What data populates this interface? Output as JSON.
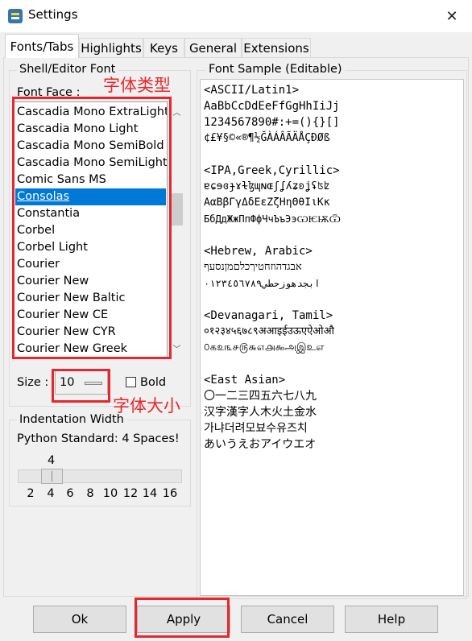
{
  "window": {
    "title": "Settings"
  },
  "tabs": [
    {
      "label": "Fonts/Tabs"
    },
    {
      "label": "Highlights"
    },
    {
      "label": "Keys"
    },
    {
      "label": "General"
    },
    {
      "label": "Extensions"
    }
  ],
  "font_group": {
    "legend": "Shell/Editor Font",
    "face_label": "Font Face :",
    "fonts": [
      "Cascadia Mono ExtraLight",
      "Cascadia Mono Light",
      "Cascadia Mono SemiBold",
      "Cascadia Mono SemiLight",
      "Comic Sans MS",
      "Consolas",
      "Constantia",
      "Corbel",
      "Corbel Light",
      "Courier",
      "Courier New",
      "Courier New Baltic",
      "Courier New CE",
      "Courier New CYR",
      "Courier New Greek"
    ],
    "selected_font": "Consolas",
    "size_label": "Size :",
    "size_value": "10",
    "bold_label": "Bold",
    "bold_checked": false
  },
  "annotations": {
    "font_type_note": "字体类型",
    "font_size_note": "字体大小"
  },
  "indent_group": {
    "legend": "Indentation Width",
    "description": "Python Standard: 4 Spaces!",
    "current_value": "4",
    "ticks": [
      "2",
      "4",
      "6",
      "8",
      "10",
      "12",
      "14",
      "16"
    ]
  },
  "sample": {
    "legend": "Font Sample (Editable)",
    "lines": [
      "<ASCII/Latin1>",
      "AaBbCcDdEeFfGgHhIiJj",
      "1234567890#:+=(){}[]",
      "¢£¥§©«®¶½ĞÀÁÂÃÄÅÇÐØß",
      "",
      "<IPA,Greek,Cyrillic>",
      "ɐɕɘɞɟɤɫɮɰɴɶʃʆʎʑʚʝʢʦʫ",
      "ΑαΒβΓγΔδΕεΖζΗηΘθΙιΚκ",
      "БбДдЖжПпФфЧчЪъЭэѠѤѬѾ",
      "",
      "<Hebrew, Arabic>",
      "אבגדהוזחטיךכלםמןנסעף",
      "ابجدهوزحطي٠١٢٣٤٥٦٧٨٩",
      "",
      "<Devanagari, Tamil>",
      "०१२३४५६७८९अआइईउऊएऐओऔ",
      "௦௧௨௩௪௫௬௭௮௯அஇஉஎ",
      "",
      "<East Asian>",
      "〇一二三四五六七八九",
      "汉字漢字人木火土金水",
      "가냐더려모뵤수유즈치",
      "あいうえおアイウエオ"
    ]
  },
  "buttons": {
    "ok": "Ok",
    "apply": "Apply",
    "cancel": "Cancel",
    "help": "Help"
  }
}
